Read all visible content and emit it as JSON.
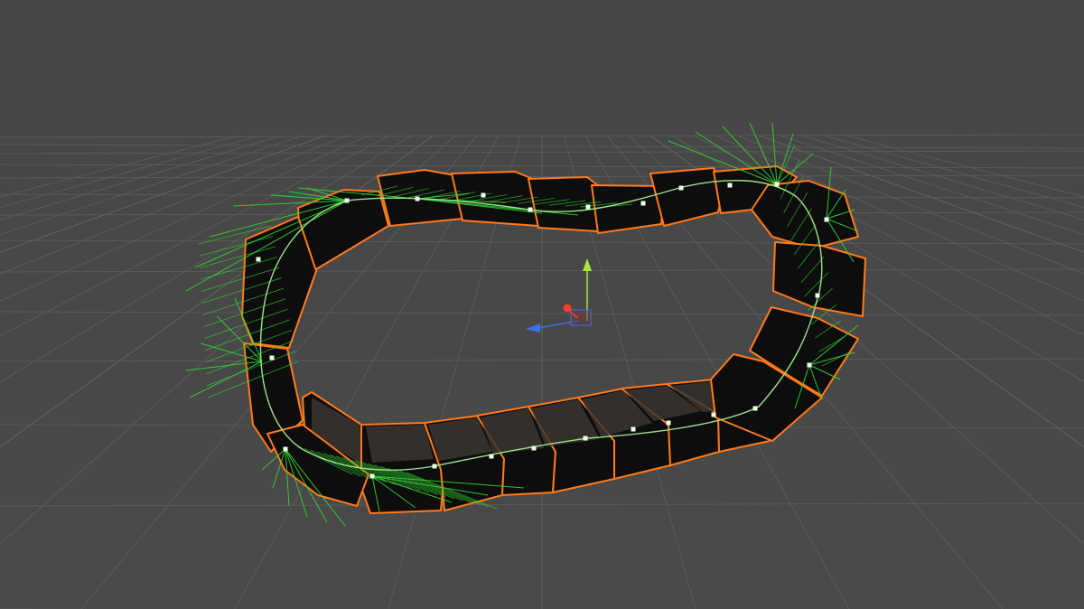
{
  "scene": {
    "view": "3d-viewport",
    "object": "tank-track",
    "colors": {
      "background": "#484848",
      "grid": "#5e5e5e",
      "grid_major": "#6a6a6a",
      "selection_outline": "#ff7a1a",
      "spline": "#9be38b",
      "tangent_lines": "#33d633",
      "control_points": "#e8ffe8",
      "track_pad": "#0d0d0d",
      "track_pad_inner": "#3c3631",
      "axis_y": "#a6e83d",
      "axis_z": "#3c6ff0",
      "axis_x": "#ff3b2b",
      "pivot_box": "#6a3a3a"
    },
    "icons": {
      "gizmo": "transform-gizmo-icon",
      "pivot": "pivot-icon"
    }
  }
}
